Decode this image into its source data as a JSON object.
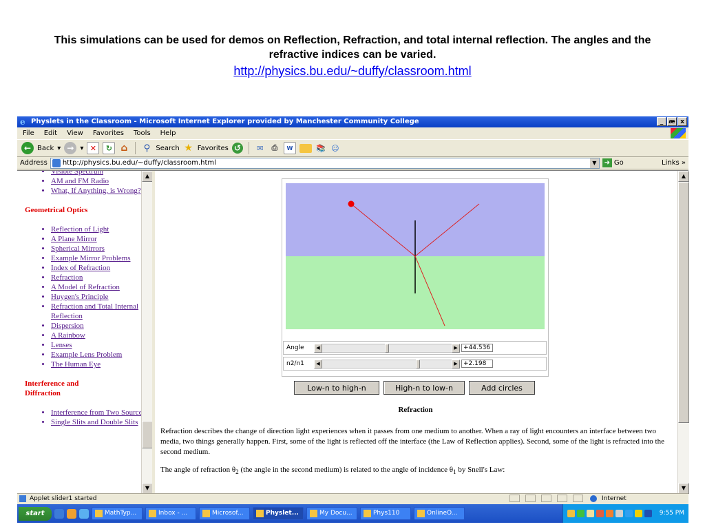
{
  "slide": {
    "title": "This simulations can be used for demos on Reflection, Refraction, and total internal reflection. The angles and the refractive indices can be varied.",
    "link": "http://physics.bu.edu/~duffy/classroom.html"
  },
  "window": {
    "title": "Physlets in the Classroom - Microsoft Internet Explorer provided by Manchester Community College",
    "controls": [
      "_",
      "æ",
      "x"
    ]
  },
  "menu": [
    "File",
    "Edit",
    "View",
    "Favorites",
    "Tools",
    "Help"
  ],
  "toolbar": {
    "back": "Back",
    "search": "Search",
    "favorites": "Favorites"
  },
  "address": {
    "label": "Address",
    "url": "http://physics.bu.edu/~duffy/classroom.html",
    "go": "Go",
    "links": "Links"
  },
  "sidebar": {
    "items_top": [
      "Visible Spectrum",
      "AM and FM Radio",
      "What, If Anything, is Wrong?"
    ],
    "section_optics": "Geometrical Optics",
    "items_optics": [
      "Reflection of Light",
      "A Plane Mirror",
      "Spherical Mirrors",
      "Example Mirror Problems",
      "Index of Refraction",
      "Refraction",
      "A Model of Refraction",
      "Huygen's Principle",
      "Refraction and Total Internal Reflection",
      "Dispersion",
      "A Rainbow",
      "Lenses",
      "Example Lens Problem",
      "The Human Eye"
    ],
    "section_interference": "Interference and Diffraction",
    "items_interference": [
      "Interference from Two Sources",
      "Single Slits and Double Slits"
    ]
  },
  "applet": {
    "colors": {
      "top_medium": "#b0b0f0",
      "bottom_medium": "#b0f0b0",
      "ray": "#dd2222",
      "source": "#ee0000",
      "normal": "#000000"
    },
    "angle_label": "Angle",
    "angle_value": "+44.536",
    "angle_fraction": 0.5,
    "n_label": "n2/n1",
    "n_value": "+2.198",
    "n_fraction": 0.75,
    "buttons": [
      "Low-n to high-n",
      "High-n to low-n",
      "Add circles"
    ]
  },
  "article": {
    "heading": "Refraction",
    "para1": "Refraction describes the change of direction light experiences when it passes from one medium to another. When a ray of light encounters an interface between two media, two things generally happen. First, some of the light is reflected off the interface (the Law of Reflection applies). Second, some of the light is refracted into the second medium.",
    "para2_a": "The angle of refraction θ",
    "para2_sub1": "2",
    "para2_b": " (the angle in the second medium) is related to the angle of incidence θ",
    "para2_sub2": "1",
    "para2_c": " by Snell's Law:"
  },
  "status": {
    "text": "Applet slider1 started",
    "zone": "Internet"
  },
  "taskbar": {
    "start": "start",
    "tasks": [
      "MathTyp...",
      "Inbox - ...",
      "Microsof...",
      "Physlet...",
      "My Docu...",
      "Phys110",
      "OnlineO..."
    ],
    "active_index": 3,
    "clock": "9:55 PM"
  }
}
